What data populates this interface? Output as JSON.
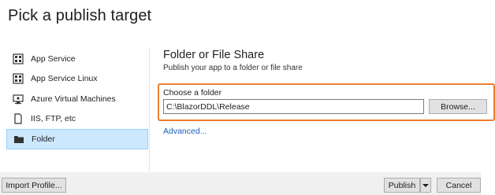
{
  "header": {
    "title": "Pick a publish target"
  },
  "sidebar": {
    "items": [
      {
        "label": "App Service",
        "icon": "app-service-icon",
        "selected": false
      },
      {
        "label": "App Service Linux",
        "icon": "app-service-linux-icon",
        "selected": false
      },
      {
        "label": "Azure Virtual Machines",
        "icon": "virtual-machine-icon",
        "selected": false
      },
      {
        "label": "IIS, FTP, etc",
        "icon": "document-icon",
        "selected": false
      },
      {
        "label": "Folder",
        "icon": "folder-icon",
        "selected": true
      }
    ]
  },
  "main": {
    "title": "Folder or File Share",
    "subtitle": "Publish your app to a folder or file share",
    "folder_label": "Choose a folder",
    "folder_value": "C:\\BlazorDDL\\Release",
    "browse_label": "Browse...",
    "advanced_link": "Advanced..."
  },
  "footer": {
    "import_label": "Import Profile...",
    "publish_label": "Publish",
    "cancel_label": "Cancel"
  },
  "colors": {
    "highlight": "#ed7d31",
    "selection": "#cce8ff",
    "link": "#1a5fb4"
  }
}
